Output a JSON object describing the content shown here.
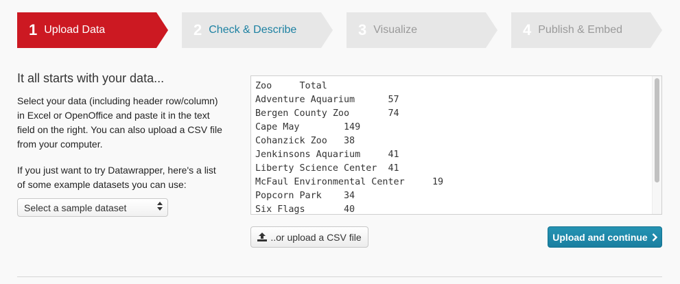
{
  "steps": [
    {
      "number": "1",
      "label": "Upload Data",
      "state": "active",
      "color": "#cc1922"
    },
    {
      "number": "2",
      "label": "Check & Describe",
      "state": "next",
      "color": "#e7e7e7"
    },
    {
      "number": "3",
      "label": "Visualize",
      "state": "disabled",
      "color": "#e7e7e7"
    },
    {
      "number": "4",
      "label": "Publish & Embed",
      "state": "disabled",
      "color": "#e7e7e7"
    }
  ],
  "intro": {
    "heading": "It all starts with your data...",
    "paragraph1": "Select your data (including header row/column) in Excel or OpenOffice and paste it in the text field on the right. You can also upload a CSV file from your computer.",
    "paragraph2": "If you just want to try Datawrapper, here's a list of some example datasets you can use:"
  },
  "sample_select": {
    "value": "Select a sample dataset",
    "icon": "updown-arrows-icon"
  },
  "data_input": {
    "value": "Zoo\tTotal\nAdventure Aquarium\t57\nBergen County Zoo\t74\nCape May\t149\nCohanzick Zoo\t38\nJenkinsons Aquarium\t41\nLiberty Science Center\t41\nMcFaul Environmental Center\t19\nPopcorn Park\t34\nSix Flags\t40"
  },
  "buttons": {
    "upload_csv": "..or upload a CSV file",
    "upload_csv_icon": "upload-icon",
    "upload_continue": "Upload and continue",
    "upload_continue_icon": "chevron-right-icon"
  },
  "colors": {
    "accent_red": "#cc1922",
    "accent_blue": "#1d81a2",
    "step_inactive": "#e7e7e7"
  }
}
